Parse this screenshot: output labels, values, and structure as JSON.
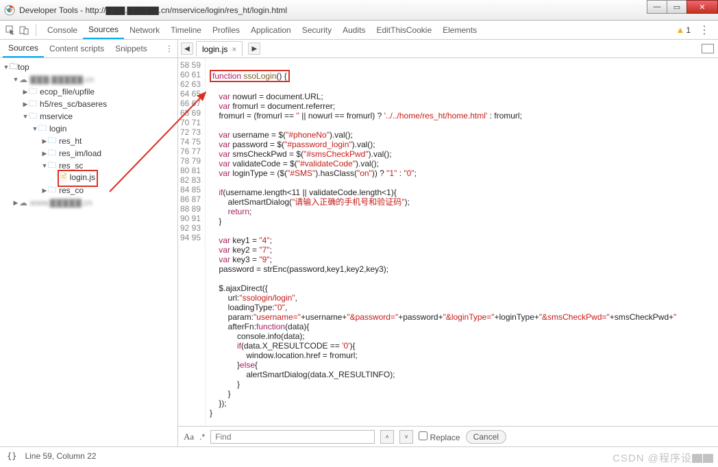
{
  "window": {
    "title": "Developer Tools - http://▇▇▇.▇▇▇▇▇.cn/mservice/login/res_ht/login.html"
  },
  "toolbar": {
    "tabs": [
      "Console",
      "Sources",
      "Network",
      "Timeline",
      "Profiles",
      "Application",
      "Security",
      "Audits",
      "EditThisCookie",
      "Elements"
    ],
    "active": "Sources",
    "warnings": "1"
  },
  "sidebar": {
    "subtabs": [
      "Sources",
      "Content scripts",
      "Snippets"
    ],
    "active": "Sources",
    "tree": {
      "top": "top",
      "d1": "▇▇▇.▇▇▇▇▇.cn",
      "ecop": "ecop_file/upfile",
      "h5": "h5/res_sc/baseres",
      "mservice": "mservice",
      "login": "login",
      "res_ht": "res_ht",
      "res_im": "res_im/load",
      "res_sc": "res_sc",
      "loginjs": "login.js",
      "res_co": "res_co",
      "d2": "www.▇▇▇▇▇.cn"
    }
  },
  "editor": {
    "tab": "login.js",
    "cursor": "Line 59, Column 22",
    "startLine": 58,
    "lines": [
      "",
      "<span class='hl-fn'><span class='kw'>function</span> <span class='fn'>ssoLogin</span>() {</span>",
      "",
      "    <span class='kw'>var</span> nowurl = document.URL;",
      "    <span class='kw'>var</span> fromurl = document.referrer;",
      "    fromurl = (fromurl == <span class='str'>''</span> || nowurl == fromurl) ? <span class='str'>'../../home/res_ht/home.html'</span> : fromurl;",
      "",
      "    <span class='kw'>var</span> username = $(<span class='str'>\"#phoneNo\"</span>).val();",
      "    <span class='kw'>var</span> password = $(<span class='str'>\"#password_login\"</span>).val();",
      "    <span class='kw'>var</span> smsCheckPwd = $(<span class='str'>\"#smsCheckPwd\"</span>).val();",
      "    <span class='kw'>var</span> validateCode = $(<span class='str'>\"#validateCode\"</span>).val();",
      "    <span class='kw'>var</span> loginType = ($(<span class='str'>\"#SMS\"</span>).hasClass(<span class='str'>\"on\"</span>)) ? <span class='str'>\"1\"</span> : <span class='str'>\"0\"</span>;",
      "",
      "    <span class='kw'>if</span>(username.length&lt;11 || validateCode.length&lt;1){",
      "        alertSmartDialog(<span class='str'>\"请输入正确的手机号和验证码\"</span>);",
      "        <span class='kw'>return</span>;",
      "    }",
      "",
      "    <span class='kw'>var</span> key1 = <span class='str'>\"4\"</span>;",
      "    <span class='kw'>var</span> key2 = <span class='str'>\"7\"</span>;",
      "    <span class='kw'>var</span> key3 = <span class='str'>\"9\"</span>;",
      "    password = strEnc(password,key1,key2,key3);",
      "",
      "    $.ajaxDirect({",
      "        url:<span class='str'>\"ssologin/login\"</span>,",
      "        loadingType:<span class='str'>\"0\"</span>,",
      "        param:<span class='str'>\"username=\"</span>+username+<span class='str'>\"&amp;password=\"</span>+password+<span class='str'>\"&amp;loginType=\"</span>+loginType+<span class='str'>\"&amp;smsCheckPwd=\"</span>+smsCheckPwd+<span class='str'>\"</span>",
      "        afterFn:<span class='kw'>function</span>(data){",
      "            console.info(data);",
      "            <span class='kw'>if</span>(data.X_RESULTCODE == <span class='str'>'0'</span>){",
      "                window.location.href = fromurl;",
      "            }<span class='kw'>else</span>{",
      "                alertSmartDialog(data.X_RESULTINFO);",
      "            }",
      "        }",
      "    });",
      "}",
      ""
    ]
  },
  "findbar": {
    "placeholder": "Find",
    "replace": "Replace",
    "cancel": "Cancel"
  },
  "watermark": "CSDN @程序设▇▇"
}
